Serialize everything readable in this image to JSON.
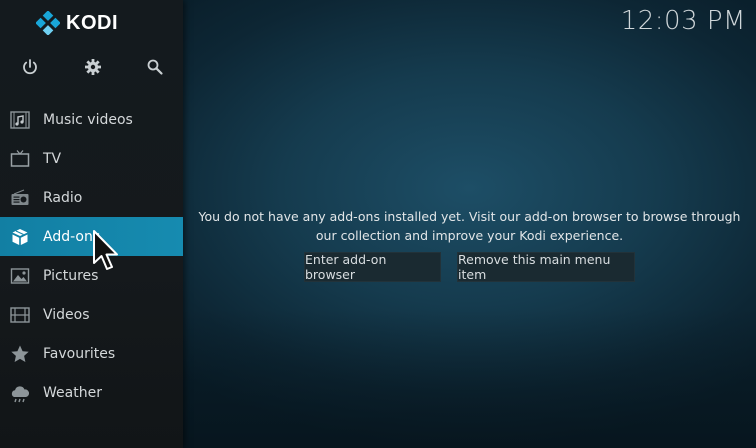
{
  "app": {
    "name": "KODI"
  },
  "clock": "12:03 PM",
  "top_icons": [
    "power-icon",
    "settings-icon",
    "search-icon"
  ],
  "menu": [
    {
      "label": "Music videos",
      "icon": "music-video-icon",
      "active": false
    },
    {
      "label": "TV",
      "icon": "tv-icon",
      "active": false
    },
    {
      "label": "Radio",
      "icon": "radio-icon",
      "active": false
    },
    {
      "label": "Add-ons",
      "icon": "addons-box-icon",
      "active": true
    },
    {
      "label": "Pictures",
      "icon": "pictures-icon",
      "active": false
    },
    {
      "label": "Videos",
      "icon": "film-icon",
      "active": false
    },
    {
      "label": "Favourites",
      "icon": "star-icon",
      "active": false
    },
    {
      "label": "Weather",
      "icon": "weather-icon",
      "active": false
    }
  ],
  "message": {
    "line1": "You do not have any add-ons installed yet. Visit our add-on browser to browse through",
    "line2": "our collection and improve your Kodi experience."
  },
  "buttons": {
    "enter_browser": "Enter add-on browser",
    "remove_item": "Remove this main menu item"
  },
  "colors": {
    "accent": "#1284a8",
    "sidebar": "#15191c",
    "background": "#153b4e"
  }
}
